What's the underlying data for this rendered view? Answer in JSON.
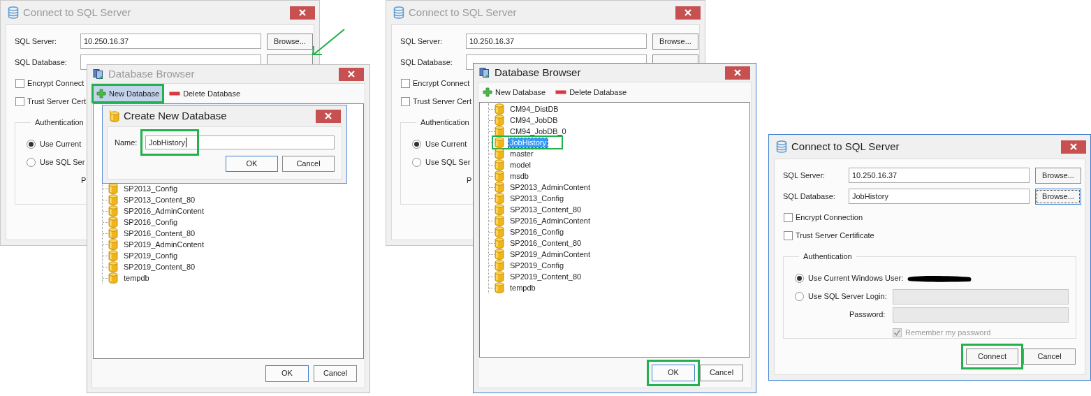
{
  "panels": [
    {
      "connect": {
        "title": "Connect to SQL Server",
        "active": false,
        "server": {
          "label": "SQL Server:",
          "value": "10.250.16.37",
          "browse": "Browse..."
        },
        "database": {
          "label": "SQL Database:"
        },
        "options": [
          {
            "label": "Encrypt Connect",
            "checked": false
          },
          {
            "label": "Trust Server Cert",
            "checked": false
          }
        ],
        "auth": {
          "title": "Authentication",
          "choices": [
            {
              "label": "Use Current",
              "selected": true
            },
            {
              "label": "Use SQL Ser",
              "selected": false
            }
          ],
          "password_label": "P"
        }
      },
      "browser": {
        "title": "Database Browser",
        "active": false,
        "tools": [
          {
            "kind": "add",
            "label": "New Database",
            "highlighted": true
          },
          {
            "kind": "remove",
            "label": "Delete Database",
            "highlighted": false
          }
        ],
        "databases": [
          {
            "name": "SP2013_Config",
            "selected": false,
            "highlighted": false
          },
          {
            "name": "SP2013_Content_80",
            "selected": false,
            "highlighted": false
          },
          {
            "name": "SP2016_AdminContent",
            "selected": false,
            "highlighted": false
          },
          {
            "name": "SP2016_Config",
            "selected": false,
            "highlighted": false
          },
          {
            "name": "SP2016_Content_80",
            "selected": false,
            "highlighted": false
          },
          {
            "name": "SP2019_AdminContent",
            "selected": false,
            "highlighted": false
          },
          {
            "name": "SP2019_Config",
            "selected": false,
            "highlighted": false
          },
          {
            "name": "SP2019_Content_80",
            "selected": false,
            "highlighted": false
          },
          {
            "name": "tempdb",
            "selected": false,
            "highlighted": false
          }
        ],
        "buttons": [
          {
            "label": "OK",
            "default": true,
            "highlighted": false
          },
          {
            "label": "Cancel",
            "default": false,
            "highlighted": false
          }
        ]
      },
      "create_dialog": {
        "title": "Create New Database",
        "name_label": "Name:",
        "name_value": "JobHistory",
        "name_highlighted": true,
        "buttons": [
          {
            "label": "OK",
            "default": true
          },
          {
            "label": "Cancel",
            "default": false
          }
        ]
      },
      "arrow": true
    },
    {
      "connect": {
        "title": "Connect to SQL Server",
        "active": false,
        "server": {
          "label": "SQL Server:",
          "value": "10.250.16.37",
          "browse": "Browse..."
        },
        "database": {
          "label": "SQL Database:"
        },
        "options": [
          {
            "label": "Encrypt Connect",
            "checked": false
          },
          {
            "label": "Trust Server Cert",
            "checked": false
          }
        ],
        "auth": {
          "title": "Authentication",
          "choices": [
            {
              "label": "Use Current",
              "selected": true
            },
            {
              "label": "Use SQL Ser",
              "selected": false
            }
          ],
          "password_label": "P"
        }
      },
      "browser": {
        "title": "Database Browser",
        "active": true,
        "tools": [
          {
            "kind": "add",
            "label": "New Database",
            "highlighted": false
          },
          {
            "kind": "remove",
            "label": "Delete Database",
            "highlighted": false
          }
        ],
        "databases": [
          {
            "name": "CM94_DistDB",
            "selected": false,
            "highlighted": false
          },
          {
            "name": "CM94_JobDB",
            "selected": false,
            "highlighted": false
          },
          {
            "name": "CM94_JobDB_0",
            "selected": false,
            "highlighted": false
          },
          {
            "name": "JobHistory",
            "selected": true,
            "highlighted": true
          },
          {
            "name": "master",
            "selected": false,
            "highlighted": false
          },
          {
            "name": "model",
            "selected": false,
            "highlighted": false
          },
          {
            "name": "msdb",
            "selected": false,
            "highlighted": false
          },
          {
            "name": "SP2013_AdminContent",
            "selected": false,
            "highlighted": false
          },
          {
            "name": "SP2013_Config",
            "selected": false,
            "highlighted": false
          },
          {
            "name": "SP2013_Content_80",
            "selected": false,
            "highlighted": false
          },
          {
            "name": "SP2016_AdminContent",
            "selected": false,
            "highlighted": false
          },
          {
            "name": "SP2016_Config",
            "selected": false,
            "highlighted": false
          },
          {
            "name": "SP2016_Content_80",
            "selected": false,
            "highlighted": false
          },
          {
            "name": "SP2019_AdminContent",
            "selected": false,
            "highlighted": false
          },
          {
            "name": "SP2019_Config",
            "selected": false,
            "highlighted": false
          },
          {
            "name": "SP2019_Content_80",
            "selected": false,
            "highlighted": false
          },
          {
            "name": "tempdb",
            "selected": false,
            "highlighted": false
          }
        ],
        "buttons": [
          {
            "label": "OK",
            "default": true,
            "highlighted": true
          },
          {
            "label": "Cancel",
            "default": false,
            "highlighted": false
          }
        ]
      }
    },
    {
      "connect": {
        "title": "Connect to SQL Server",
        "active": true,
        "server": {
          "label": "SQL Server:",
          "value": "10.250.16.37",
          "browse": "Browse..."
        },
        "database": {
          "label": "SQL Database:",
          "value": "JobHistory",
          "browse": "Browse..."
        },
        "options": [
          {
            "label": "Encrypt Connection",
            "checked": false
          },
          {
            "label": "Trust Server Certificate",
            "checked": false
          }
        ],
        "auth": {
          "title": "Authentication",
          "choices": [
            {
              "label": "Use Current Windows User:",
              "selected": true,
              "user_redacted": true
            },
            {
              "label": "Use SQL Server Login:",
              "selected": false,
              "field_disabled": true
            }
          ],
          "password_label": "Password:",
          "password_disabled": true,
          "remember": {
            "label": "Remember my password",
            "checked": true,
            "disabled": true
          }
        },
        "buttons": [
          {
            "label": "Connect",
            "highlighted": true
          },
          {
            "label": "Cancel",
            "highlighted": false
          }
        ]
      }
    }
  ]
}
